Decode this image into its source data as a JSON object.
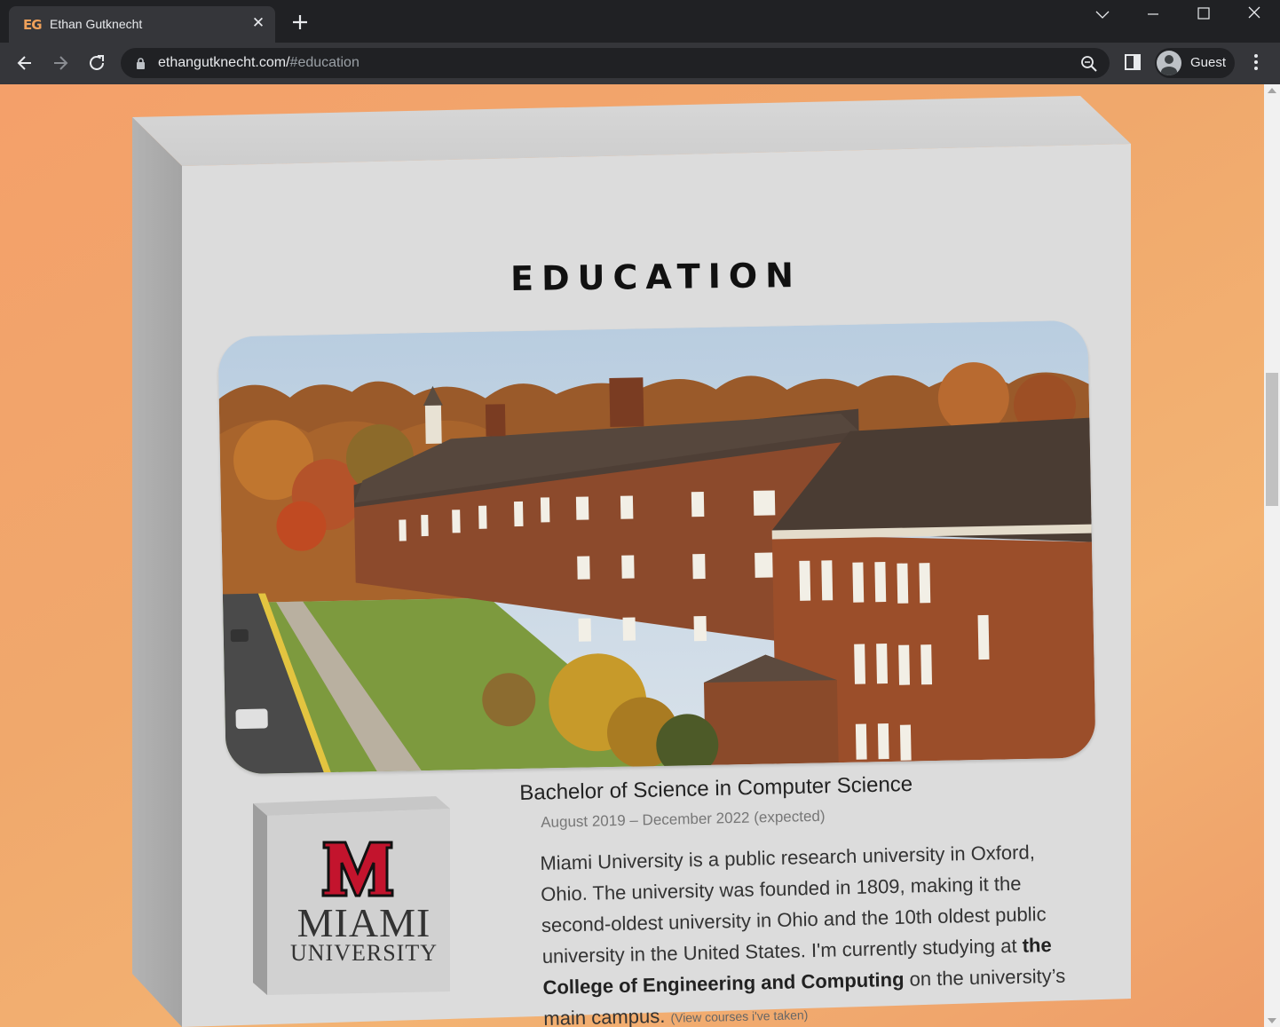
{
  "browser": {
    "tab_title": "Ethan Gutknecht",
    "favicon_text": "EG",
    "url_domain": "ethangutknecht.com/",
    "url_hash": "#education",
    "profile_label": "Guest"
  },
  "education": {
    "heading": "EDUCATION",
    "logo": {
      "line1": "MIAMI",
      "line2": "UNIVERSITY",
      "color": "#c3142d"
    },
    "degree": "Bachelor of Science in Computer Science",
    "dates": "August 2019 – December 2022 (expected)",
    "desc_part1": "Miami University is a public research university in Oxford, Ohio. The university was founded in 1809, making it the second-oldest university in Ohio and the 10th oldest public university in the United States. I'm currently studying at",
    "desc_bold": "the College of Engineering and Computing",
    "desc_part2": "on the university’s main campus.",
    "courses_link": "(View courses i've taken)"
  },
  "colors": {
    "page_gradient_start": "#f4a06a",
    "page_gradient_end": "#ee9d68",
    "card_face": "#dcdcdc",
    "card_top": "#d2d2d2",
    "card_side": "#a9a9a9"
  }
}
